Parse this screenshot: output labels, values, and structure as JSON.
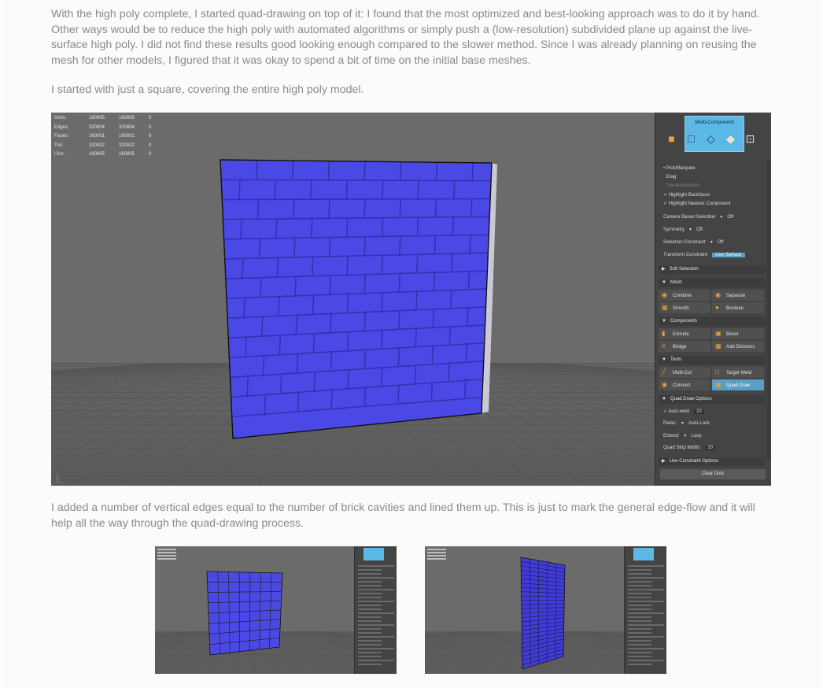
{
  "article": {
    "paragraphs": [
      "With the high poly complete, I started quad-drawing on top of it: I found that the most optimized and best-looking approach was to do it by hand. Other ways would be to reduce the high poly with automated algorithms or simply push a (low-resolution) subdivided plane up against the live-surface high poly. I did not find these results good looking enough compared to the slower method. Since I was already planning on reusing the mesh for other models, I figured that it was okay to spend a bit of time on the initial base meshes.",
      "I started with just a square, covering the entire high poly model.",
      "I added a number of vertical edges equal to the number of brick cavities and lined them up. This is just to mark the general edge-flow and it will help all the way through the quad-drawing process."
    ]
  },
  "viewport": {
    "stats": [
      {
        "label": "Verts:",
        "a": "160805",
        "b": "160805",
        "c": "0"
      },
      {
        "label": "Edges:",
        "a": "320804",
        "b": "320804",
        "c": "0"
      },
      {
        "label": "Faces:",
        "a": "160001",
        "b": "160001",
        "c": "0"
      },
      {
        "label": "Tris:",
        "a": "320002",
        "b": "320002",
        "c": "0"
      },
      {
        "label": "UVs:",
        "a": "160805",
        "b": "160805",
        "c": "0"
      }
    ],
    "colors": {
      "background": "#6b6b6b",
      "mesh": "#4b49e6",
      "mortar": "#3434b8",
      "grid": "#575757"
    }
  },
  "toolkit": {
    "title": "Multi-Component",
    "component_icons": [
      "object-cube-icon",
      "vertex-icon",
      "edge-icon",
      "face-icon",
      "uv-icon"
    ],
    "options": {
      "pick_marquee": "Pick/Marquee",
      "drag": "Drag",
      "tweak_marquee": "Tweak/Marquee",
      "highlight_backfaces": "Highlight Backfaces",
      "highlight_nearest": "Highlight Nearest Component",
      "camera_based_selection": "Camera Based Selection",
      "camera_based_value": "Off",
      "symmetry": "Symmetry",
      "symmetry_value": "Off",
      "selection_constraint": "Selection Constraint",
      "selection_constraint_value": "Off",
      "transform_constraint": "Transform Constraint",
      "transform_constraint_value": "Live Surface"
    },
    "sections": {
      "soft_selection": "Soft Selection",
      "mesh": "Mesh",
      "components": "Components",
      "tools": "Tools",
      "quad_draw_options": "Quad Draw Options",
      "live_constraint_options": "Live Constraint Options"
    },
    "tools": {
      "combine": "Combine",
      "separate": "Separate",
      "smooth": "Smooth",
      "boolean": "Boolean",
      "extrude": "Extrude",
      "bevel": "Bevel",
      "bridge": "Bridge",
      "add_divisions": "Add Divisions",
      "multi_cut": "Multi-Cut",
      "target_weld": "Target Weld",
      "connect": "Connect",
      "quad_draw": "Quad Draw"
    },
    "quad_draw": {
      "auto_weld": "Auto-weld",
      "auto_weld_value": "10",
      "relax": "Relax:",
      "relax_value": "Auto-Lock",
      "extend": "Extend:",
      "extend_value": "Loop",
      "strip_width": "Quad Strip Width:",
      "strip_width_value": "20"
    },
    "clear_dots": "Clear Dots"
  }
}
